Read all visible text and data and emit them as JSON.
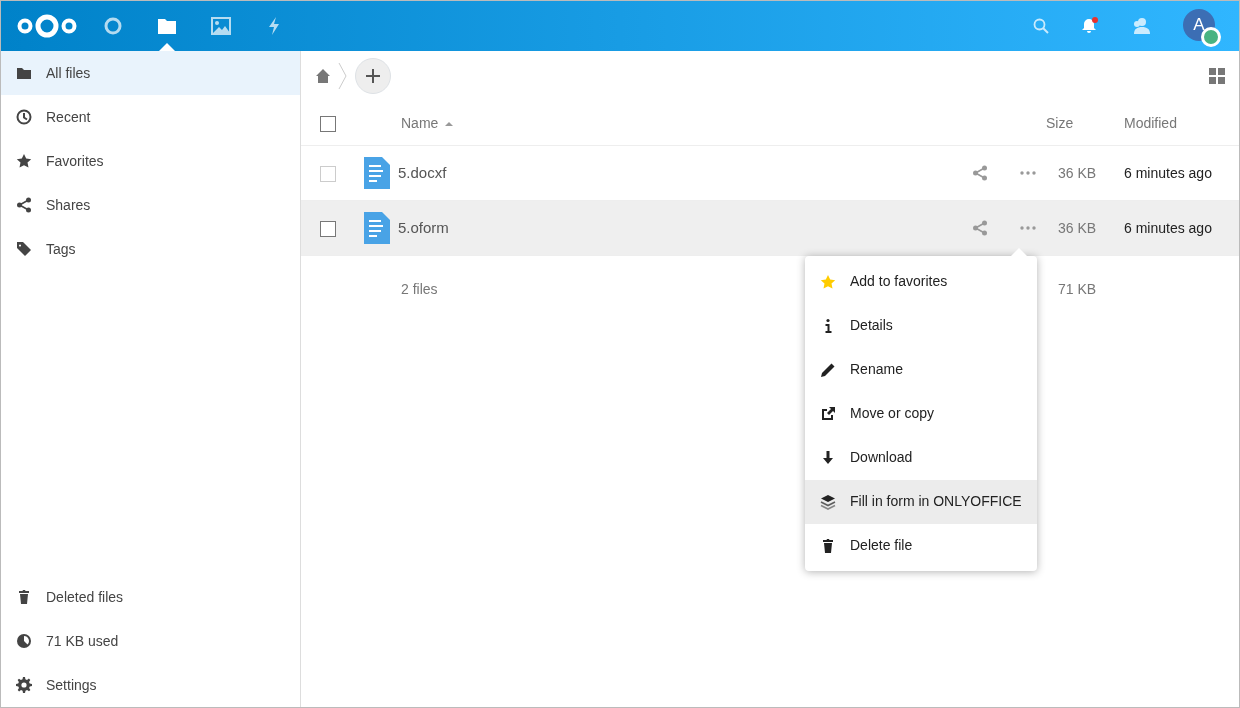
{
  "header": {
    "apps": [
      {
        "selected": false
      },
      {
        "selected": true
      },
      {
        "selected": false
      },
      {
        "selected": false
      }
    ],
    "avatar": "A"
  },
  "sidebar": {
    "items": [
      {
        "label": "All files",
        "selected": true
      },
      {
        "label": "Recent",
        "selected": false
      },
      {
        "label": "Favorites",
        "selected": false
      },
      {
        "label": "Shares",
        "selected": false
      },
      {
        "label": "Tags",
        "selected": false
      }
    ],
    "footer": [
      {
        "label": "Deleted files"
      },
      {
        "label": "71 KB used"
      },
      {
        "label": "Settings"
      }
    ]
  },
  "table": {
    "columns": [
      "Name",
      "Size",
      "Modified"
    ],
    "all_checked": false,
    "rows": [
      {
        "name": "5.docxf",
        "size": "36 KB",
        "modified": "6 minutes ago",
        "checked": false,
        "highlighted": false
      },
      {
        "name": "5.oform",
        "size": "36 KB",
        "modified": "6 minutes ago",
        "checked": false,
        "highlighted": true
      }
    ],
    "summary": {
      "count": "2 files",
      "size": "71 KB"
    }
  },
  "menu": {
    "items": [
      {
        "label": "Add to favorites",
        "highlighted": false
      },
      {
        "label": "Details",
        "highlighted": false
      },
      {
        "label": "Rename",
        "highlighted": false
      },
      {
        "label": "Move or copy",
        "highlighted": false
      },
      {
        "label": "Download",
        "highlighted": false
      },
      {
        "label": "Fill in form in ONLYOFFICE",
        "highlighted": true
      },
      {
        "label": "Delete file",
        "highlighted": false
      }
    ]
  }
}
